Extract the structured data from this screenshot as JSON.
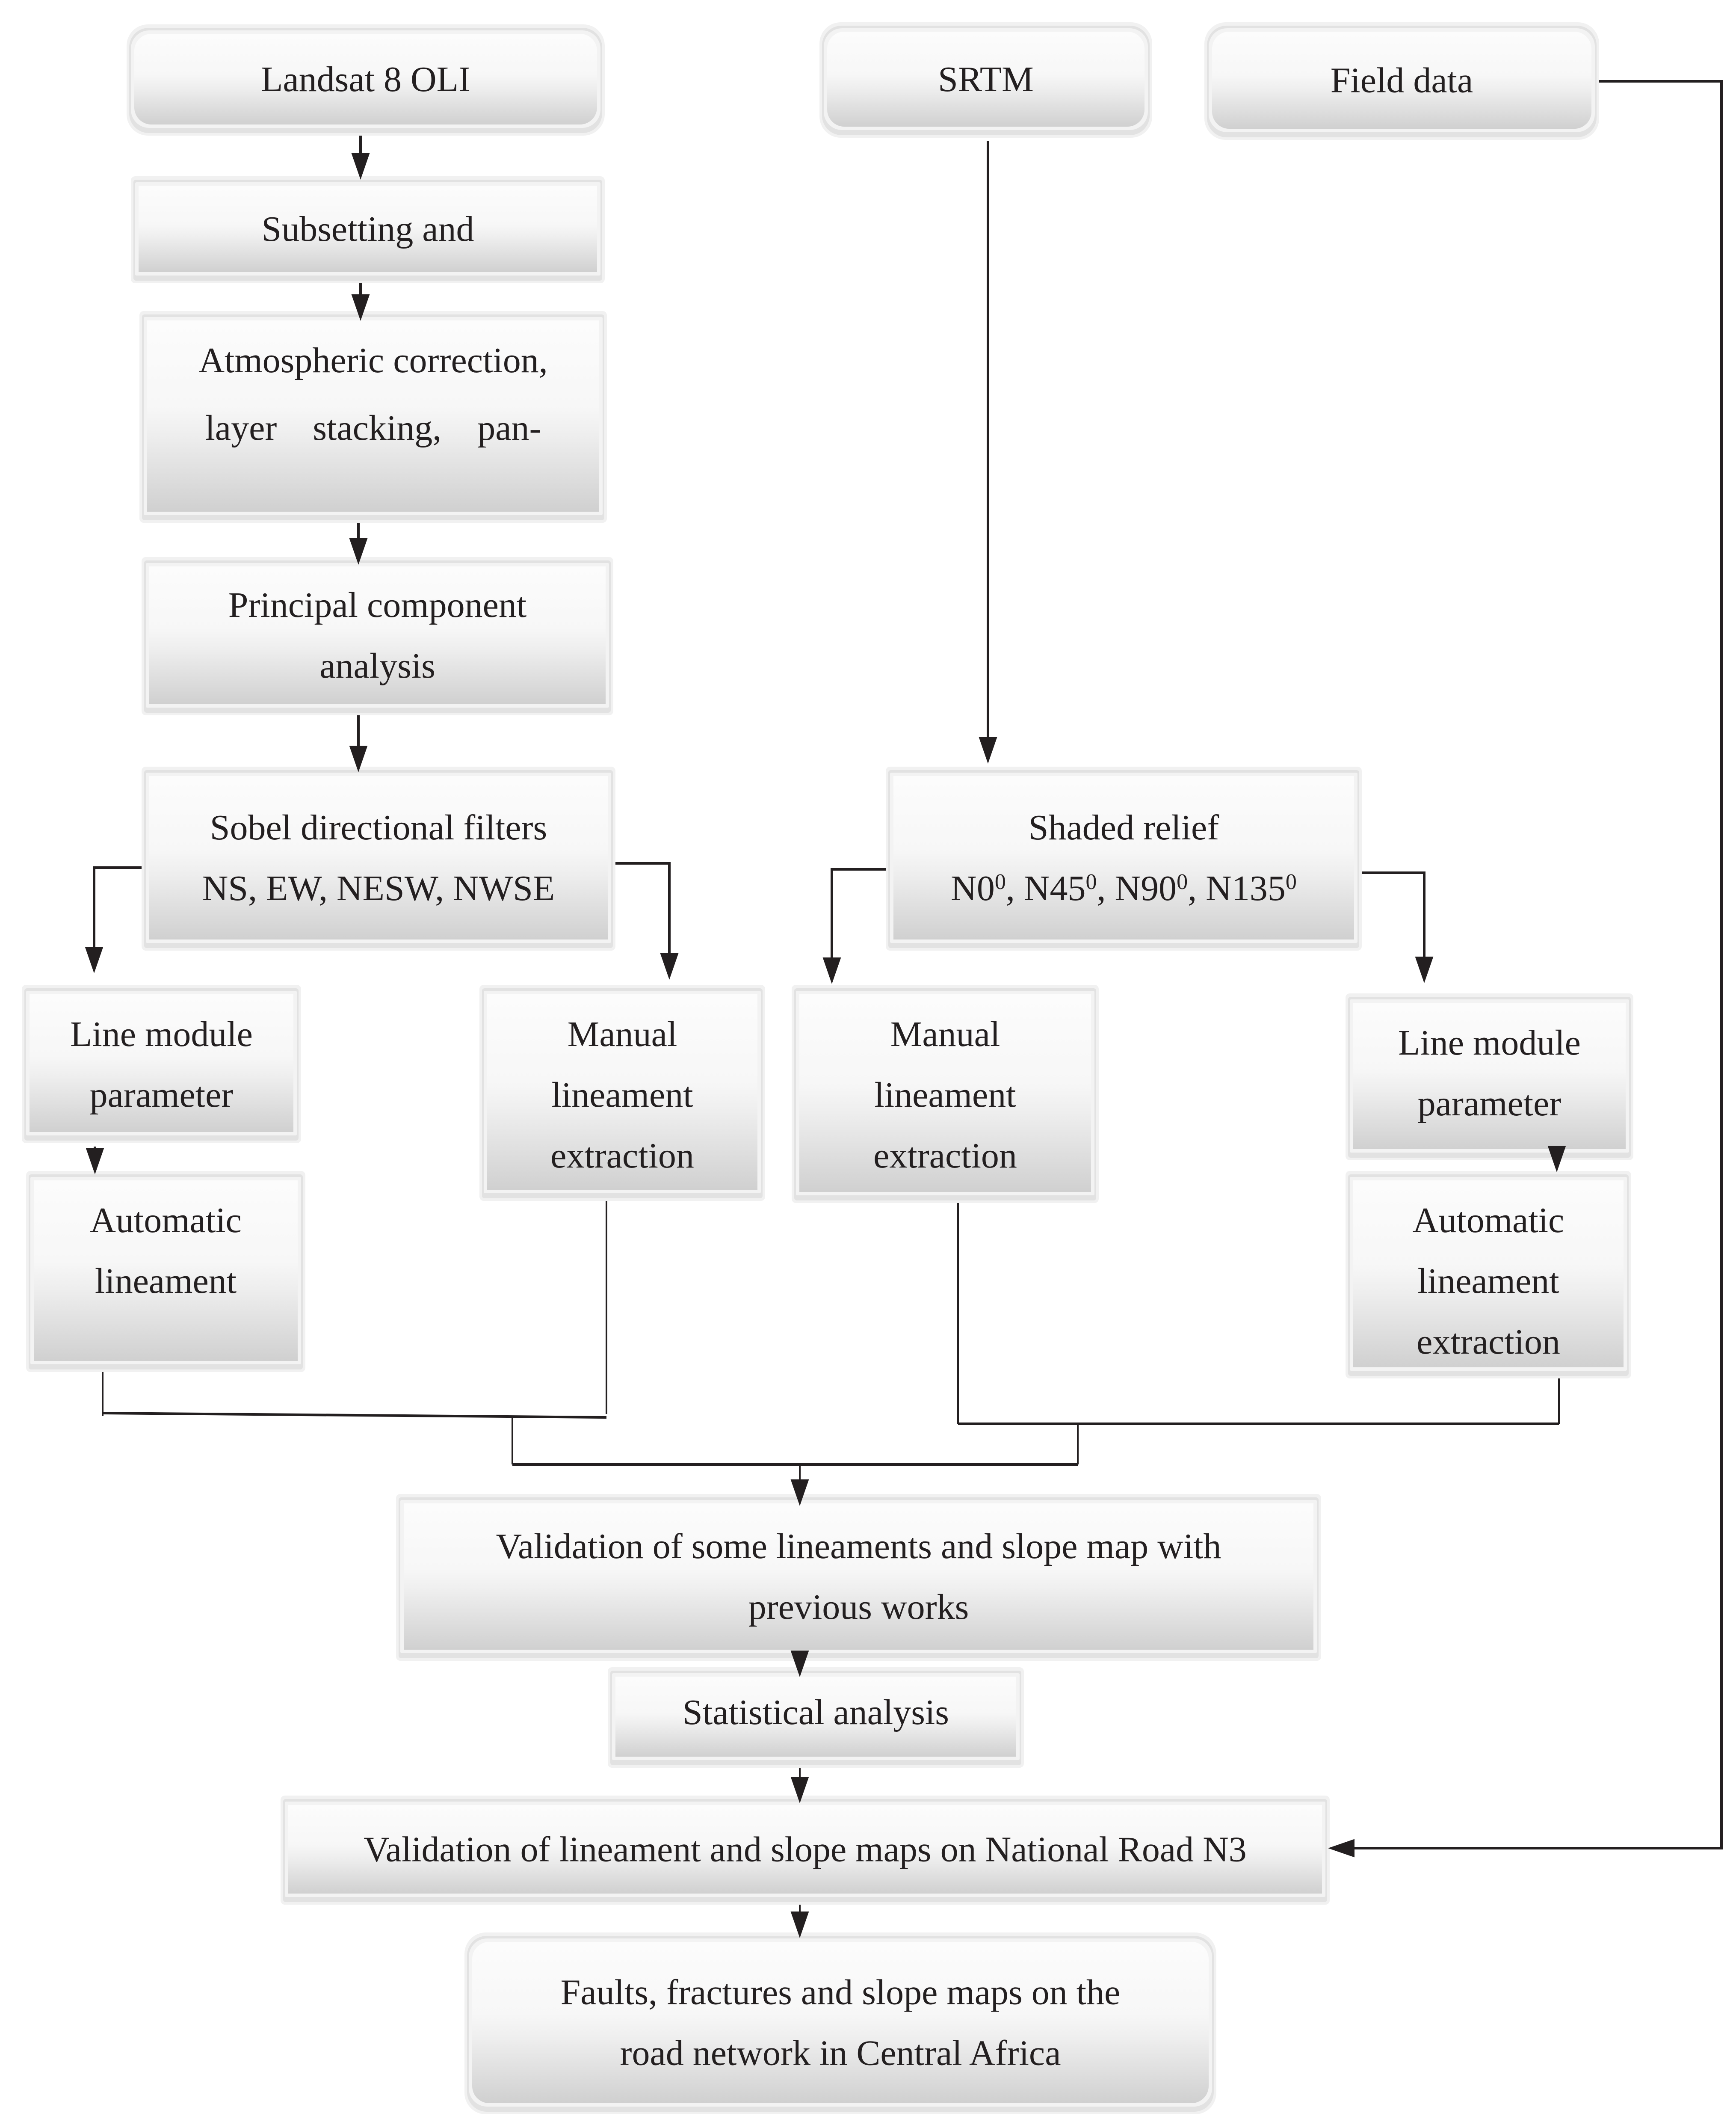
{
  "diagram": {
    "type": "flowchart",
    "nodes": [
      {
        "id": "landsat",
        "lines": [
          "Landsat 8 OLI"
        ],
        "shape": "rounded"
      },
      {
        "id": "subsetting",
        "lines": [
          "Subsetting and"
        ],
        "shape": "rect"
      },
      {
        "id": "atmospheric",
        "lines": [
          "Atmospheric correction,",
          "layer    stacking,    pan-"
        ],
        "shape": "rect"
      },
      {
        "id": "pca",
        "lines": [
          "Principal component",
          "analysis"
        ],
        "shape": "rect"
      },
      {
        "id": "sobel",
        "lines": [
          "Sobel directional filters",
          "NS, EW, NESW, NWSE"
        ],
        "shape": "rect"
      },
      {
        "id": "srtm",
        "lines": [
          "SRTM"
        ],
        "shape": "rounded"
      },
      {
        "id": "field",
        "lines": [
          "Field data"
        ],
        "shape": "rounded"
      },
      {
        "id": "shaded",
        "lines": [
          "Shaded relief"
        ],
        "angles": [
          "N0",
          "N45",
          "N90",
          "N135"
        ],
        "degree_mark": "0",
        "shape": "rect"
      },
      {
        "id": "line_module_left",
        "lines": [
          "Line module",
          "parameter"
        ],
        "shape": "rect"
      },
      {
        "id": "auto_left",
        "lines": [
          "Automatic",
          "lineament"
        ],
        "shape": "rect"
      },
      {
        "id": "manual_left",
        "lines": [
          "Manual",
          "lineament",
          "extraction"
        ],
        "shape": "rect"
      },
      {
        "id": "manual_right",
        "lines": [
          "Manual",
          "lineament",
          "extraction"
        ],
        "shape": "rect"
      },
      {
        "id": "line_module_right",
        "lines": [
          "Line module",
          "parameter"
        ],
        "shape": "rect"
      },
      {
        "id": "auto_right",
        "lines": [
          "Automatic",
          "lineament",
          "extraction"
        ],
        "shape": "rect"
      },
      {
        "id": "validation_previous",
        "lines": [
          "Validation of some lineaments and slope map with",
          "previous works"
        ],
        "shape": "rect"
      },
      {
        "id": "statistical",
        "lines": [
          "Statistical analysis"
        ],
        "shape": "rect"
      },
      {
        "id": "validation_n3",
        "lines": [
          "Validation of lineament and slope maps on National Road N3"
        ],
        "shape": "rect"
      },
      {
        "id": "faults",
        "lines": [
          "Faults, fractures and slope maps on the",
          "road network in Central Africa"
        ],
        "shape": "rounded"
      }
    ],
    "edges": [
      {
        "from": "landsat",
        "to": "subsetting"
      },
      {
        "from": "subsetting",
        "to": "atmospheric"
      },
      {
        "from": "atmospheric",
        "to": "pca"
      },
      {
        "from": "pca",
        "to": "sobel"
      },
      {
        "from": "sobel",
        "to": "line_module_left"
      },
      {
        "from": "sobel",
        "to": "manual_left"
      },
      {
        "from": "line_module_left",
        "to": "auto_left"
      },
      {
        "from": "srtm",
        "to": "shaded"
      },
      {
        "from": "shaded",
        "to": "manual_right"
      },
      {
        "from": "shaded",
        "to": "line_module_right"
      },
      {
        "from": "line_module_right",
        "to": "auto_right"
      },
      {
        "from": [
          "auto_left",
          "manual_left",
          "manual_right",
          "auto_right"
        ],
        "to": "validation_previous"
      },
      {
        "from": "validation_previous",
        "to": "statistical"
      },
      {
        "from": "statistical",
        "to": "validation_n3"
      },
      {
        "from": "field",
        "to": "validation_n3"
      },
      {
        "from": "validation_n3",
        "to": "faults"
      }
    ]
  }
}
